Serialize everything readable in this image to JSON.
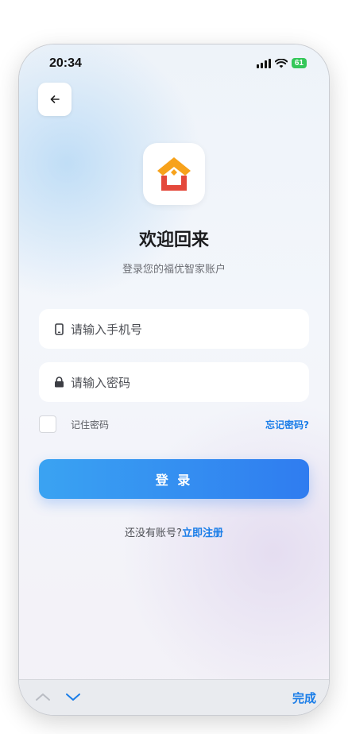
{
  "status_bar": {
    "time": "20:34",
    "battery": "61",
    "icons": [
      "signal-icon",
      "wifi-icon",
      "battery-icon"
    ]
  },
  "header": {
    "back_icon": "back-arrow-icon"
  },
  "logo": {
    "icon": "house-logo-icon",
    "colors": [
      "#f7a21b",
      "#e4483b"
    ]
  },
  "title": "欢迎回来",
  "subtitle": "登录您的福优智家账户",
  "form": {
    "phone_placeholder": "请输入手机号",
    "phone_value": "",
    "password_placeholder": "请输入密码",
    "password_value": "",
    "remember_label": "记住密码",
    "remember_checked": false,
    "forgot_label": "忘记密码?",
    "login_label": "登 录"
  },
  "register": {
    "prompt": "还没有账号?",
    "link": "立即注册"
  },
  "keyboard_toolbar": {
    "up_icon": "chevron-up-icon",
    "down_icon": "chevron-down-icon",
    "done_label": "完成"
  },
  "colors": {
    "accent": "#1a7de8",
    "button_start": "#3aa3f2",
    "button_end": "#2f7cf0",
    "battery": "#34c759"
  }
}
